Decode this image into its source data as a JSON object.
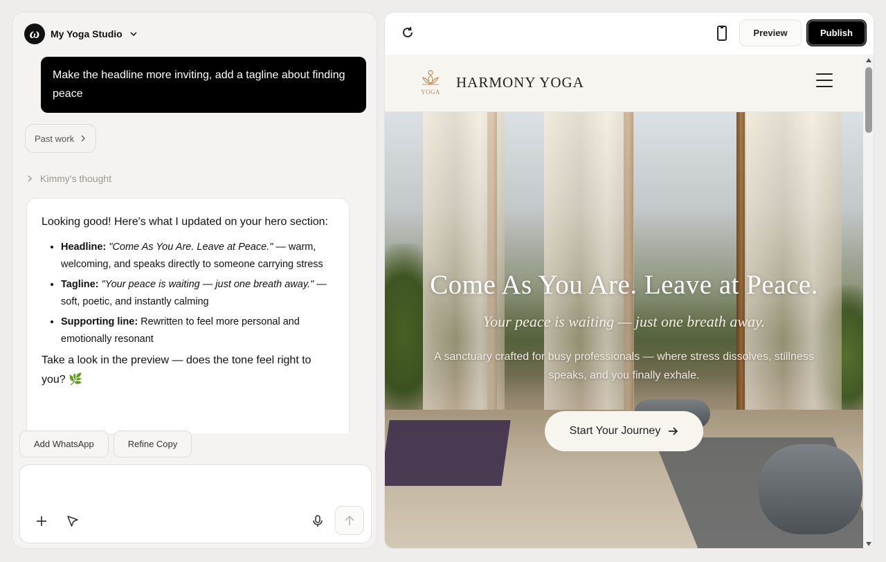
{
  "project": {
    "logo_letter": "ω",
    "name": "My Yoga Studio"
  },
  "chat": {
    "user_message": "Make the headline more inviting, add a tagline about finding peace",
    "past_work_label": "Past work",
    "thought_label": "Kimmy's thought",
    "reply": {
      "intro": "Looking good! Here's what I updated on your hero section:",
      "bullets": [
        {
          "label": "Headline:",
          "quote": "\"Come As You Are. Leave at Peace.\"",
          "rest": " — warm, welcoming, and speaks directly to someone carrying stress"
        },
        {
          "label": "Tagline:",
          "quote": "\"Your peace is waiting — just one breath away.\"",
          "rest": " — soft, poetic, and instantly calming"
        },
        {
          "label": "Supporting line:",
          "quote": "",
          "rest": " Rewritten to feel more personal and emotionally resonant"
        }
      ],
      "outro": "Take a look in the preview — does the tone feel right to you?",
      "emoji": "🌿"
    },
    "suggestions": [
      "Add WhatsApp",
      "Refine Copy"
    ],
    "composer": {
      "placeholder": ""
    }
  },
  "preview": {
    "toolbar": {
      "preview_label": "Preview",
      "publish_label": "Publish"
    },
    "site": {
      "brand_mark_text": "YOGA",
      "brand_name": "HARMONY YOGA",
      "hero": {
        "title": "Come As You Are. Leave at Peace.",
        "tagline": "Your peace is waiting — just one breath away.",
        "support": "A sanctuary crafted for busy professionals — where stress dissolves, stillness speaks, and you finally exhale.",
        "cta": "Start Your Journey"
      }
    }
  },
  "colors": {
    "accent_dark": "#000000",
    "brand_gold": "#b88a5c",
    "cta_bg": "#f8f5ef"
  }
}
